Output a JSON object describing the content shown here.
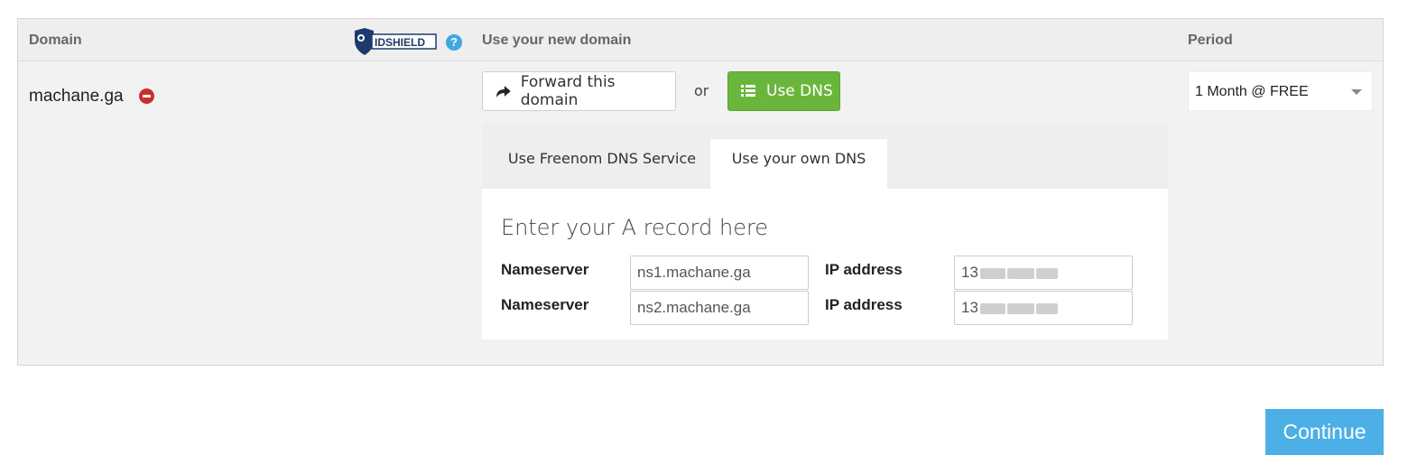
{
  "header": {
    "domain_label": "Domain",
    "use_domain_label": "Use your new domain",
    "period_label": "Period",
    "logo_text": "IDSHIELD",
    "help_glyph": "?"
  },
  "domain": {
    "name": "machane.ga"
  },
  "actions": {
    "forward_label": "Forward this domain",
    "or_label": "or",
    "dns_label": "Use DNS"
  },
  "period": {
    "selected": "1 Month @ FREE"
  },
  "dns_tabs": [
    {
      "label": "Use Freenom DNS Service",
      "active": false
    },
    {
      "label": "Use your own DNS",
      "active": true
    }
  ],
  "a_record": {
    "title": "Enter your A record here",
    "rows": [
      {
        "ns_label": "Nameserver",
        "ns_value": "ns1.machane.ga",
        "ip_label": "IP address",
        "ip_visible": "13"
      },
      {
        "ns_label": "Nameserver",
        "ns_value": "ns2.machane.ga",
        "ip_label": "IP address",
        "ip_visible": "13"
      }
    ]
  },
  "continue_label": "Continue",
  "colors": {
    "green": "#6ab63d",
    "blue": "#4cb0e6",
    "red": "#c9302c",
    "help_blue": "#3fa8e0",
    "logo_navy": "#1e3a6b"
  },
  "icons": [
    "idshield-logo",
    "help-icon",
    "remove-icon",
    "share-icon",
    "list-icon",
    "chevron-down-icon"
  ]
}
